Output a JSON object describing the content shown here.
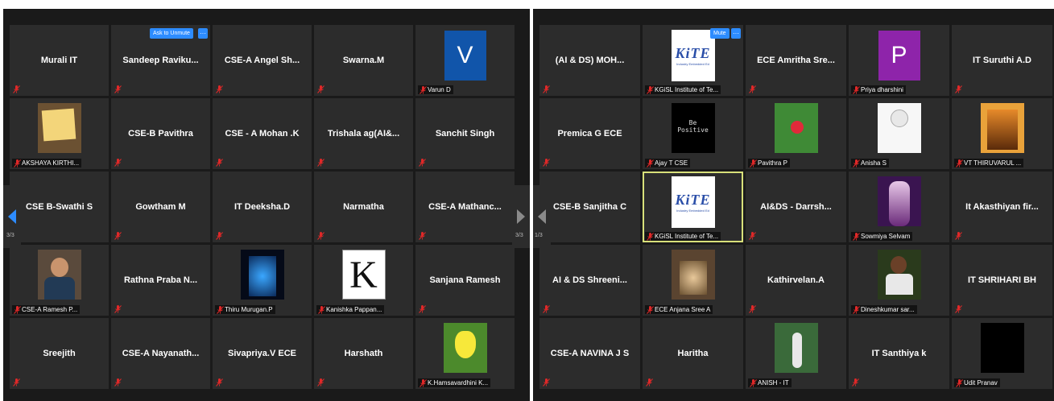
{
  "colors": {
    "accent": "#2d8cff",
    "muted_mic": "#e02828",
    "active_border": "#d8e07a",
    "tile_bg": "#2c2c2c",
    "panel_bg": "#1a1a1a"
  },
  "left": {
    "page_indicator": "3/3",
    "tiles": [
      {
        "name": "Murali IT"
      },
      {
        "name": "Sandeep  Raviku...",
        "ask_to_unmute": "Ask to Unmute",
        "more": "···"
      },
      {
        "name": "CSE-A  Angel  Sh..."
      },
      {
        "name": "Swarna.M"
      },
      {
        "label": "Varun D",
        "avatar_letter": "V",
        "avatar_color": "#1155aa"
      },
      {
        "label": "AKSHAYA KIRTHI...",
        "photo": "sticky-note"
      },
      {
        "name": "CSE-B Pavithra"
      },
      {
        "name": "CSE - A  Mohan .K"
      },
      {
        "name": "Trishala ag(AI&..."
      },
      {
        "name": "Sanchit Singh"
      },
      {
        "name": "CSE B-Swathi S"
      },
      {
        "name": "Gowtham M"
      },
      {
        "name": "IT Deeksha.D"
      },
      {
        "name": "Narmatha"
      },
      {
        "name": "CSE-A  Mathanc..."
      },
      {
        "label": "CSE-A Ramesh P...",
        "photo": "person"
      },
      {
        "name": "Rathna Praba N..."
      },
      {
        "label": "Thiru Murugan.P",
        "photo": "anime"
      },
      {
        "label": "Kanishka Pappan...",
        "photo": "letter-k"
      },
      {
        "name": "Sanjana Ramesh"
      },
      {
        "name": "Sreejith"
      },
      {
        "name": "CSE-A  Nayanath..."
      },
      {
        "name": "Sivapriya.V ECE"
      },
      {
        "name": "Harshath"
      },
      {
        "label": "K.Hamsavardhini K...",
        "photo": "tulip"
      }
    ]
  },
  "right": {
    "page_indicator": "1/3",
    "tiles": [
      {
        "name": "(AI & DS)  MOH..."
      },
      {
        "label": "KGiSL Institute of Te...",
        "photo": "kite",
        "mute": "Mute",
        "more": "···"
      },
      {
        "name": "ECE Amritha Sre..."
      },
      {
        "label": "Priya dharshini",
        "avatar_letter": "P",
        "avatar_color": "#8e24aa"
      },
      {
        "name": "IT Suruthi A.D"
      },
      {
        "name": "Premica G ECE"
      },
      {
        "label": "Ajay T CSE",
        "photo": "be-positive"
      },
      {
        "label": "Pavithra P",
        "photo": "flower"
      },
      {
        "label": "Anisha S",
        "photo": "sketch"
      },
      {
        "label": "VT THIRUVARUL ...",
        "photo": "lion"
      },
      {
        "name": "CSE-B Sanjitha C"
      },
      {
        "label": "KGiSL Institute of Te...",
        "photo": "kite",
        "active": true
      },
      {
        "name": "AI&DS - Darrsh..."
      },
      {
        "label": "Sowmiya Selvam",
        "photo": "anime-girl"
      },
      {
        "name": "It Akasthiyan fir..."
      },
      {
        "name": "AI & DS Shreeni..."
      },
      {
        "label": "ECE Anjana Sree A",
        "photo": "painting"
      },
      {
        "name": "Kathirvelan.A"
      },
      {
        "label": "Dineshkumar sar...",
        "photo": "person2"
      },
      {
        "name": "IT SHRIHARI BH"
      },
      {
        "name": "CSE-A NAVINA J S"
      },
      {
        "name": "Haritha"
      },
      {
        "label": "ANISH - IT",
        "photo": "outdoor"
      },
      {
        "name": "IT Santhiya k"
      },
      {
        "label": "Udit Pranav",
        "photo": "black"
      }
    ]
  }
}
